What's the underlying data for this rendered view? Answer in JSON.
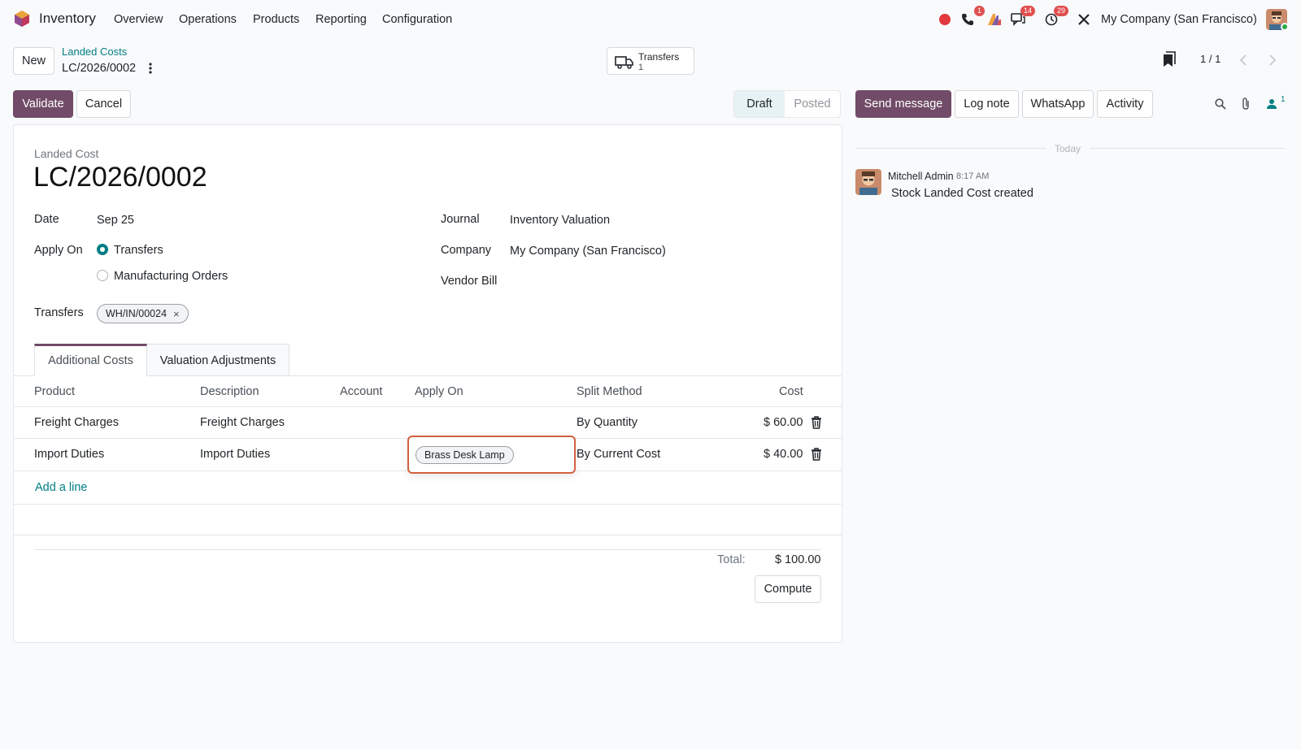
{
  "navbar": {
    "app_name": "Inventory",
    "menu": [
      "Overview",
      "Operations",
      "Products",
      "Reporting",
      "Configuration"
    ],
    "badges": {
      "phone": "1",
      "messages": "14",
      "activities": "29"
    },
    "company": "My Company (San Francisco)"
  },
  "control": {
    "new_label": "New",
    "breadcrumb": "Landed Costs",
    "record": "LC/2026/0002",
    "smart_button": {
      "label": "Transfers",
      "count": "1"
    },
    "pager": "1 / 1",
    "validate_label": "Validate",
    "cancel_label": "Cancel",
    "status": {
      "active": "Draft",
      "inactive": "Posted"
    }
  },
  "form": {
    "small_title": "Landed Cost",
    "title": "LC/2026/0002",
    "date_label": "Date",
    "date_value": "Sep 25",
    "apply_on_label": "Apply On",
    "apply_options": [
      "Transfers",
      "Manufacturing Orders"
    ],
    "transfers_label": "Transfers",
    "transfer_tag": "WH/IN/00024",
    "journal_label": "Journal",
    "journal_value": "Inventory Valuation",
    "company_label": "Company",
    "company_value": "My Company (San Francisco)",
    "vendor_bill_label": "Vendor Bill",
    "tabs": [
      "Additional Costs",
      "Valuation Adjustments"
    ]
  },
  "table": {
    "headers": [
      "Product",
      "Description",
      "Account",
      "Apply On",
      "Split Method",
      "Cost"
    ],
    "rows": [
      {
        "product": "Freight Charges",
        "description": "Freight Charges",
        "account": "",
        "apply_on": "",
        "split": "By Quantity",
        "cost": "$ 60.00"
      },
      {
        "product": "Import Duties",
        "description": "Import Duties",
        "account": "",
        "apply_on": "Brass Desk Lamp",
        "split": "By Current Cost",
        "cost": "$ 40.00"
      }
    ],
    "add_line": "Add a line",
    "total_label": "Total:",
    "total_value": "$ 100.00",
    "compute_label": "Compute"
  },
  "chatter": {
    "send_message": "Send message",
    "log_note": "Log note",
    "whatsapp": "WhatsApp",
    "activity": "Activity",
    "followers": "1",
    "day_label": "Today",
    "message": {
      "author": "Mitchell Admin",
      "time": "8:17 AM",
      "body": "Stock Landed Cost created"
    }
  },
  "colors": {
    "primary": "#714b67",
    "accent": "#017e84",
    "highlight": "#d2613f"
  }
}
